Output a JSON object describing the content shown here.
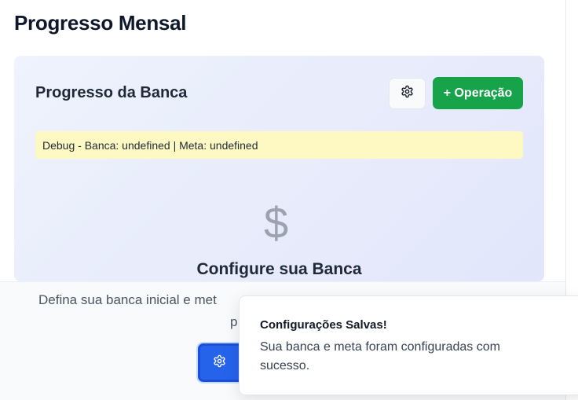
{
  "page": {
    "title": "Progresso Mensal"
  },
  "card": {
    "title": "Progresso da Banca",
    "operation_button_label": "+ Operação",
    "debug_text": "Debug - Banca: undefined | Meta: undefined",
    "empty_state_icon": "$",
    "empty_state_title": "Configure sua Banca",
    "description_line1": "Defina sua banca inicial e met",
    "description_line2": "p"
  },
  "toast": {
    "title": "Configurações Salvas!",
    "message": "Sua banca e meta foram configuradas com sucesso."
  },
  "icons": {
    "settings": "gear-icon",
    "configure": "gear-icon"
  },
  "colors": {
    "operation_button": "#16a34a",
    "configure_button": "#2563eb",
    "debug_bg": "#fef9c3"
  }
}
